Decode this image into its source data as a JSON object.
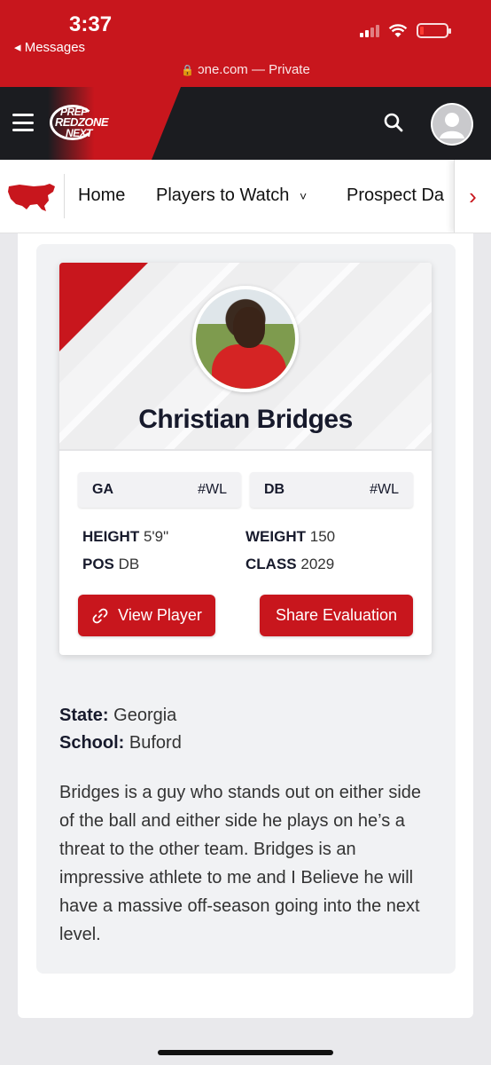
{
  "status_bar": {
    "time": "3:37",
    "back_label": "◂ Messages",
    "url_text": "ɔne.com — Private"
  },
  "header": {
    "logo_line1": "PREP",
    "logo_line2": "REDZONE",
    "logo_line3": "NEXT"
  },
  "nav": {
    "items": [
      "Home",
      "Players to Watch",
      "Prospect Da"
    ],
    "dropdown_glyph": "˅",
    "scroll_arrow": "›"
  },
  "player": {
    "name": "Christian Bridges",
    "state_tag": "GA",
    "state_rank": "#WL",
    "pos_tag": "DB",
    "pos_rank": "#WL",
    "height_label": "HEIGHT",
    "height_value": "5'9\"",
    "weight_label": "WEIGHT",
    "weight_value": "150",
    "pos_label": "POS",
    "pos_value": "DB",
    "class_label": "CLASS",
    "class_value": "2029",
    "view_button": "View Player",
    "share_button": "Share Evaluation"
  },
  "details": {
    "state_label": "State:",
    "state_value": "Georgia",
    "school_label": "School:",
    "school_value": "Buford",
    "bio": "Bridges is a guy who stands out on either side of the ball and either side he plays on he’s a threat to the other team. Bridges is an impressive athlete to me and I Believe he will have a massive off-season going into the next level."
  },
  "colors": {
    "brand_red": "#c8161d",
    "header_dark": "#1b1c20",
    "text_dark": "#171a2c"
  },
  "icons": [
    "hamburger-icon",
    "search-icon",
    "user-avatar-icon",
    "usa-map-icon",
    "chevron-right-icon",
    "link-icon",
    "wifi-icon",
    "battery-icon",
    "signal-icon",
    "lock-icon"
  ]
}
